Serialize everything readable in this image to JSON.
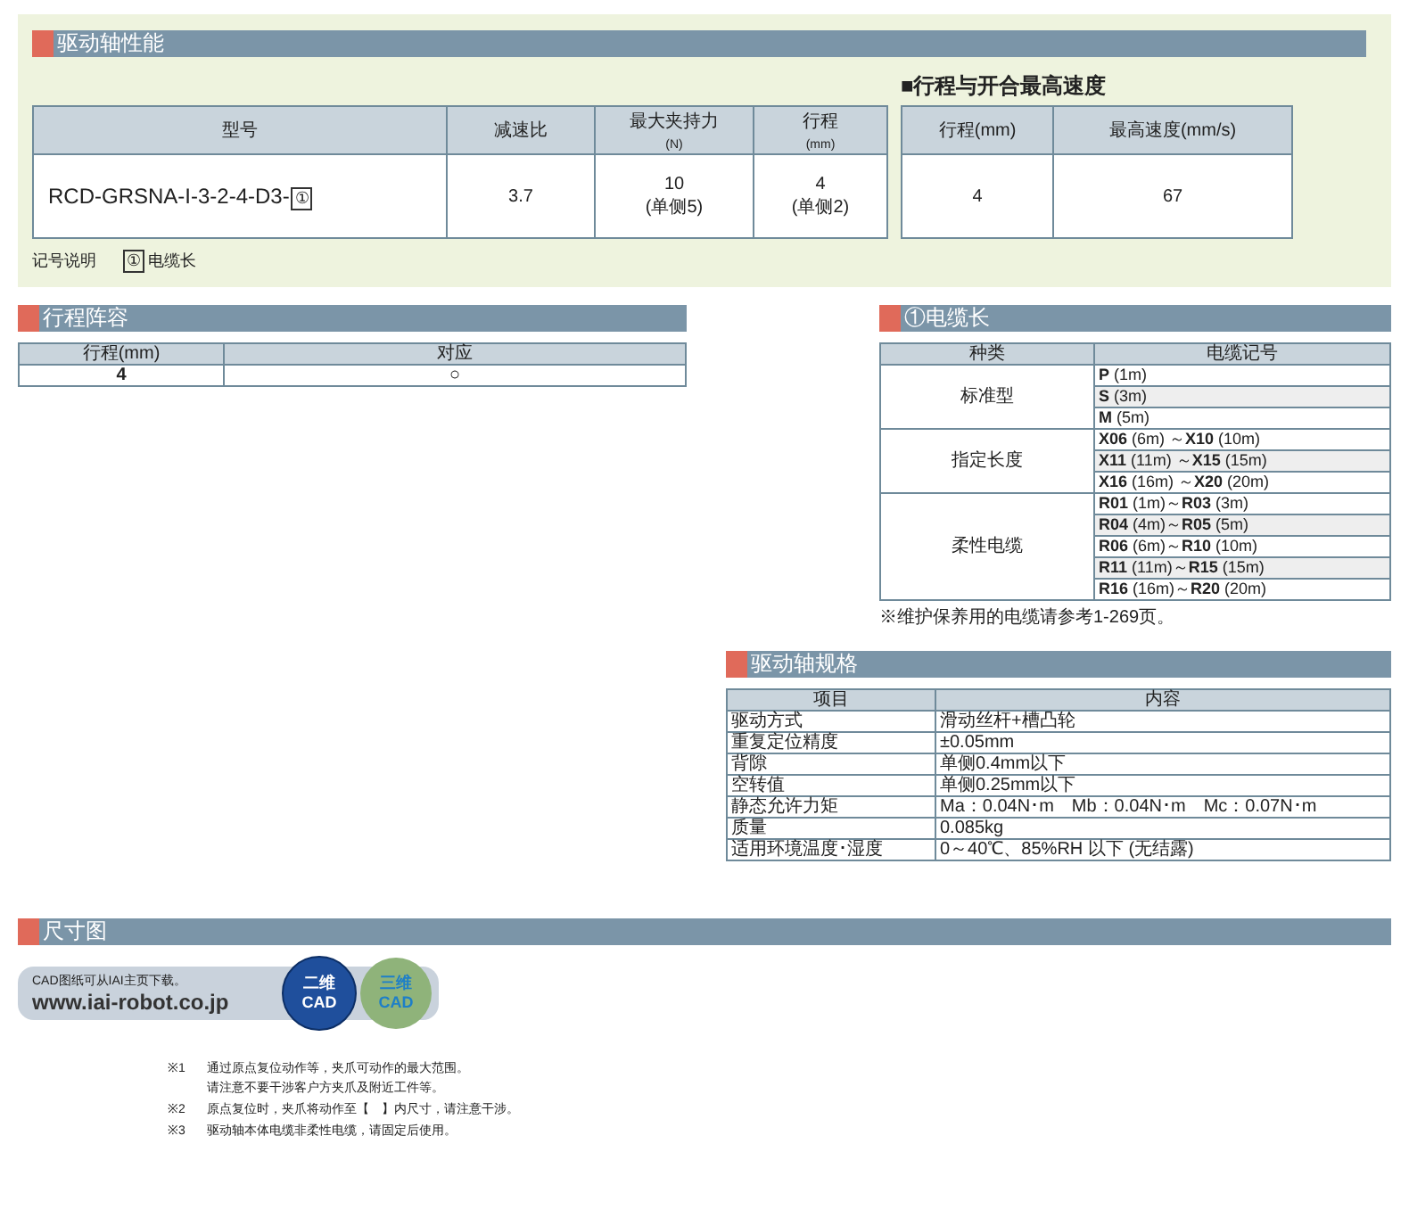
{
  "performance": {
    "title": "驱动轴性能",
    "table": {
      "columns": [
        {
          "label": "型号"
        },
        {
          "label": "减速比"
        },
        {
          "label": "最大夹持力",
          "unit": "(N)"
        },
        {
          "label": "行程",
          "unit": "(mm)"
        }
      ],
      "row": {
        "model": "RCD-GRSNA-I-3-2-4-D3-",
        "model_mark": "①",
        "ratio": "3.7",
        "force": "10",
        "force_note": "(单侧5)",
        "stroke": "4",
        "stroke_note": "(单侧2)"
      }
    },
    "legend": {
      "label": "记号说明",
      "mark": "①",
      "text": "电缆长"
    },
    "speed": {
      "title": "■行程与开合最高速度",
      "columns": [
        "行程(mm)",
        "最高速度(mm/s)"
      ],
      "row": [
        "4",
        "67"
      ]
    }
  },
  "stroke_lineup": {
    "title": "行程阵容",
    "columns": [
      "行程(mm)",
      "对应"
    ],
    "rows": [
      {
        "stroke": "4",
        "mark": "○"
      }
    ]
  },
  "cable": {
    "title": "①电缆长",
    "columns": [
      "种类",
      "电缆记号"
    ],
    "groups": [
      {
        "type": "标准型",
        "codes": [
          "**P** (1m)",
          "**S** (3m)",
          "**M** (5m)"
        ]
      },
      {
        "type": "指定长度",
        "codes": [
          "**X06** (6m) ～**X10** (10m)",
          "**X11** (11m) ～**X15** (15m)",
          "**X16** (16m) ～**X20** (20m)"
        ]
      },
      {
        "type": "柔性电缆",
        "codes": [
          "**R01** (1m)～**R03** (3m)",
          "**R04** (4m)～**R05** (5m)",
          "**R06** (6m)～**R10** (10m)",
          "**R11** (11m)～**R15** (15m)",
          "**R16** (16m)～**R20** (20m)"
        ]
      }
    ],
    "note": "※维护保养用的电缆请参考1-269页。"
  },
  "spec": {
    "title": "驱动轴规格",
    "columns": [
      "项目",
      "内容"
    ],
    "rows": [
      [
        "驱动方式",
        "滑动丝杆+槽凸轮"
      ],
      [
        "重复定位精度",
        "±0.05mm"
      ],
      [
        "背隙",
        "单侧0.4mm以下"
      ],
      [
        "空转值",
        "单侧0.25mm以下"
      ],
      [
        "静态允许力矩",
        "Ma：0.04N･m　Mb：0.04N･m　Mc：0.07N･m"
      ],
      [
        "质量",
        "0.085kg"
      ],
      [
        "适用环境温度･湿度",
        "0～40℃、85%RH 以下 (无结露)"
      ]
    ]
  },
  "dimensions": {
    "title": "尺寸图",
    "cad": {
      "caption": "CAD图纸可从IAI主页下载。",
      "url": "www.iai-robot.co.jp",
      "badges": [
        {
          "top": "二维",
          "bottom": "CAD",
          "kind": "flat"
        },
        {
          "top": "三维",
          "bottom": "CAD",
          "kind": "shaded"
        }
      ]
    },
    "notes": [
      {
        "mark": "※1",
        "lines": [
          "通过原点复位动作等，夹爪可动作的最大范围。",
          "请注意不要干涉客户方夹爪及附近工件等。"
        ]
      },
      {
        "mark": "※2",
        "lines": [
          "原点复位时，夹爪将动作至【　】内尺寸，请注意干涉。"
        ]
      },
      {
        "mark": "※3",
        "lines": [
          "驱动轴本体电缆非柔性电缆，请固定后使用。"
        ]
      }
    ]
  }
}
